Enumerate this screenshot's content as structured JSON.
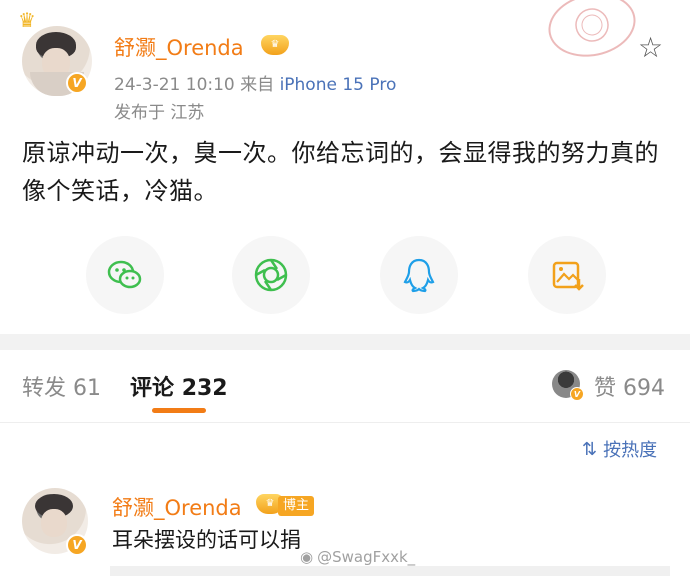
{
  "post": {
    "username": "舒灏_Orenda",
    "date": "24-3-21 10:10",
    "source_prefix": "来自",
    "device": "iPhone 15 Pro",
    "location": "发布于 江苏",
    "text": "原谅冲动一次，臭一次。你给忘词的，会显得我的努力真的像个笑话，冷猫。"
  },
  "share": [
    {
      "name": "wechat",
      "icon": "wechat-icon",
      "color": "#3fbf4f"
    },
    {
      "name": "moments",
      "icon": "moments-icon",
      "color": "#3fbf4f"
    },
    {
      "name": "qq",
      "icon": "qq-icon",
      "color": "#1e9fe8"
    },
    {
      "name": "save-image",
      "icon": "save-image-icon",
      "color": "#f2a11b"
    }
  ],
  "tabs": {
    "repost_label": "转发",
    "repost_count": "61",
    "comment_label": "评论",
    "comment_count": "232",
    "like_label": "赞",
    "like_count": "694"
  },
  "sort": {
    "label": "按热度"
  },
  "comment": {
    "username": "舒灏_Orenda",
    "tag": "博主",
    "text": "耳朵摆设的话可以捐"
  },
  "watermark": "@SwagFxxk_",
  "colors": {
    "username": "#f27c16",
    "link": "#4a72b8",
    "verified": "#f6a623"
  }
}
